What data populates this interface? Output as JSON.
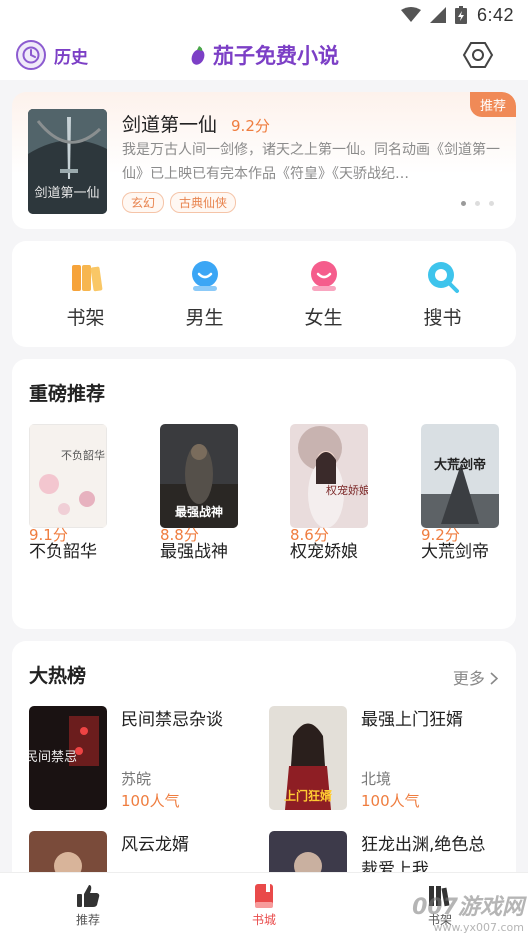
{
  "status": {
    "time": "6:42"
  },
  "header": {
    "history_label": "历史",
    "title": "茄子免费小说"
  },
  "recommend": {
    "badge": "推荐",
    "title": "剑道第一仙",
    "score": "9.2分",
    "description": "我是万古人间一剑修，诸天之上第一仙。同名动画《剑道第一仙》已上映已有完本作品《符皇》《天骄战纪…",
    "tags": [
      "玄幻",
      "古典仙侠"
    ],
    "cover_text": "剑道第一仙"
  },
  "nav": [
    {
      "label": "书架",
      "icon": "bookshelf-icon"
    },
    {
      "label": "男生",
      "icon": "male-icon"
    },
    {
      "label": "女生",
      "icon": "female-icon"
    },
    {
      "label": "搜书",
      "icon": "search-icon"
    }
  ],
  "heavy": {
    "title": "重磅推荐",
    "books": [
      {
        "name": "不负韶华",
        "score": "9.1分",
        "cover_text": "不负韶华"
      },
      {
        "name": "最强战神",
        "score": "8.8分",
        "cover_text": "最强战神"
      },
      {
        "name": "权宠娇娘",
        "score": "8.6分",
        "cover_text": "权宠娇娘"
      },
      {
        "name": "大荒剑帝",
        "score": "9.2分",
        "cover_text": "大荒剑帝"
      }
    ]
  },
  "hot": {
    "title": "大热榜",
    "more": "更多",
    "books": [
      {
        "title": "民间禁忌杂谈",
        "author": "苏皖",
        "popularity": "100人气",
        "cover_text": "民间禁忌"
      },
      {
        "title": "最强上门狂婿",
        "author": "北境",
        "popularity": "100人气",
        "cover_text": "上门狂婿"
      },
      {
        "title": "风云龙婿",
        "author": "",
        "popularity": "",
        "cover_text": ""
      },
      {
        "title": "狂龙出渊,绝色总裁爱上我",
        "author": "",
        "popularity": "",
        "cover_text": ""
      }
    ]
  },
  "tabbar": [
    {
      "label": "推荐",
      "active": false
    },
    {
      "label": "书城",
      "active": true
    },
    {
      "label": "书架",
      "active": false
    }
  ],
  "watermark": {
    "main": "007游戏网",
    "sub": "www.yx007.com"
  },
  "colors": {
    "accent": "#7c3fc6",
    "score": "#ef7d3f",
    "active_tab": "#e94a4a"
  }
}
